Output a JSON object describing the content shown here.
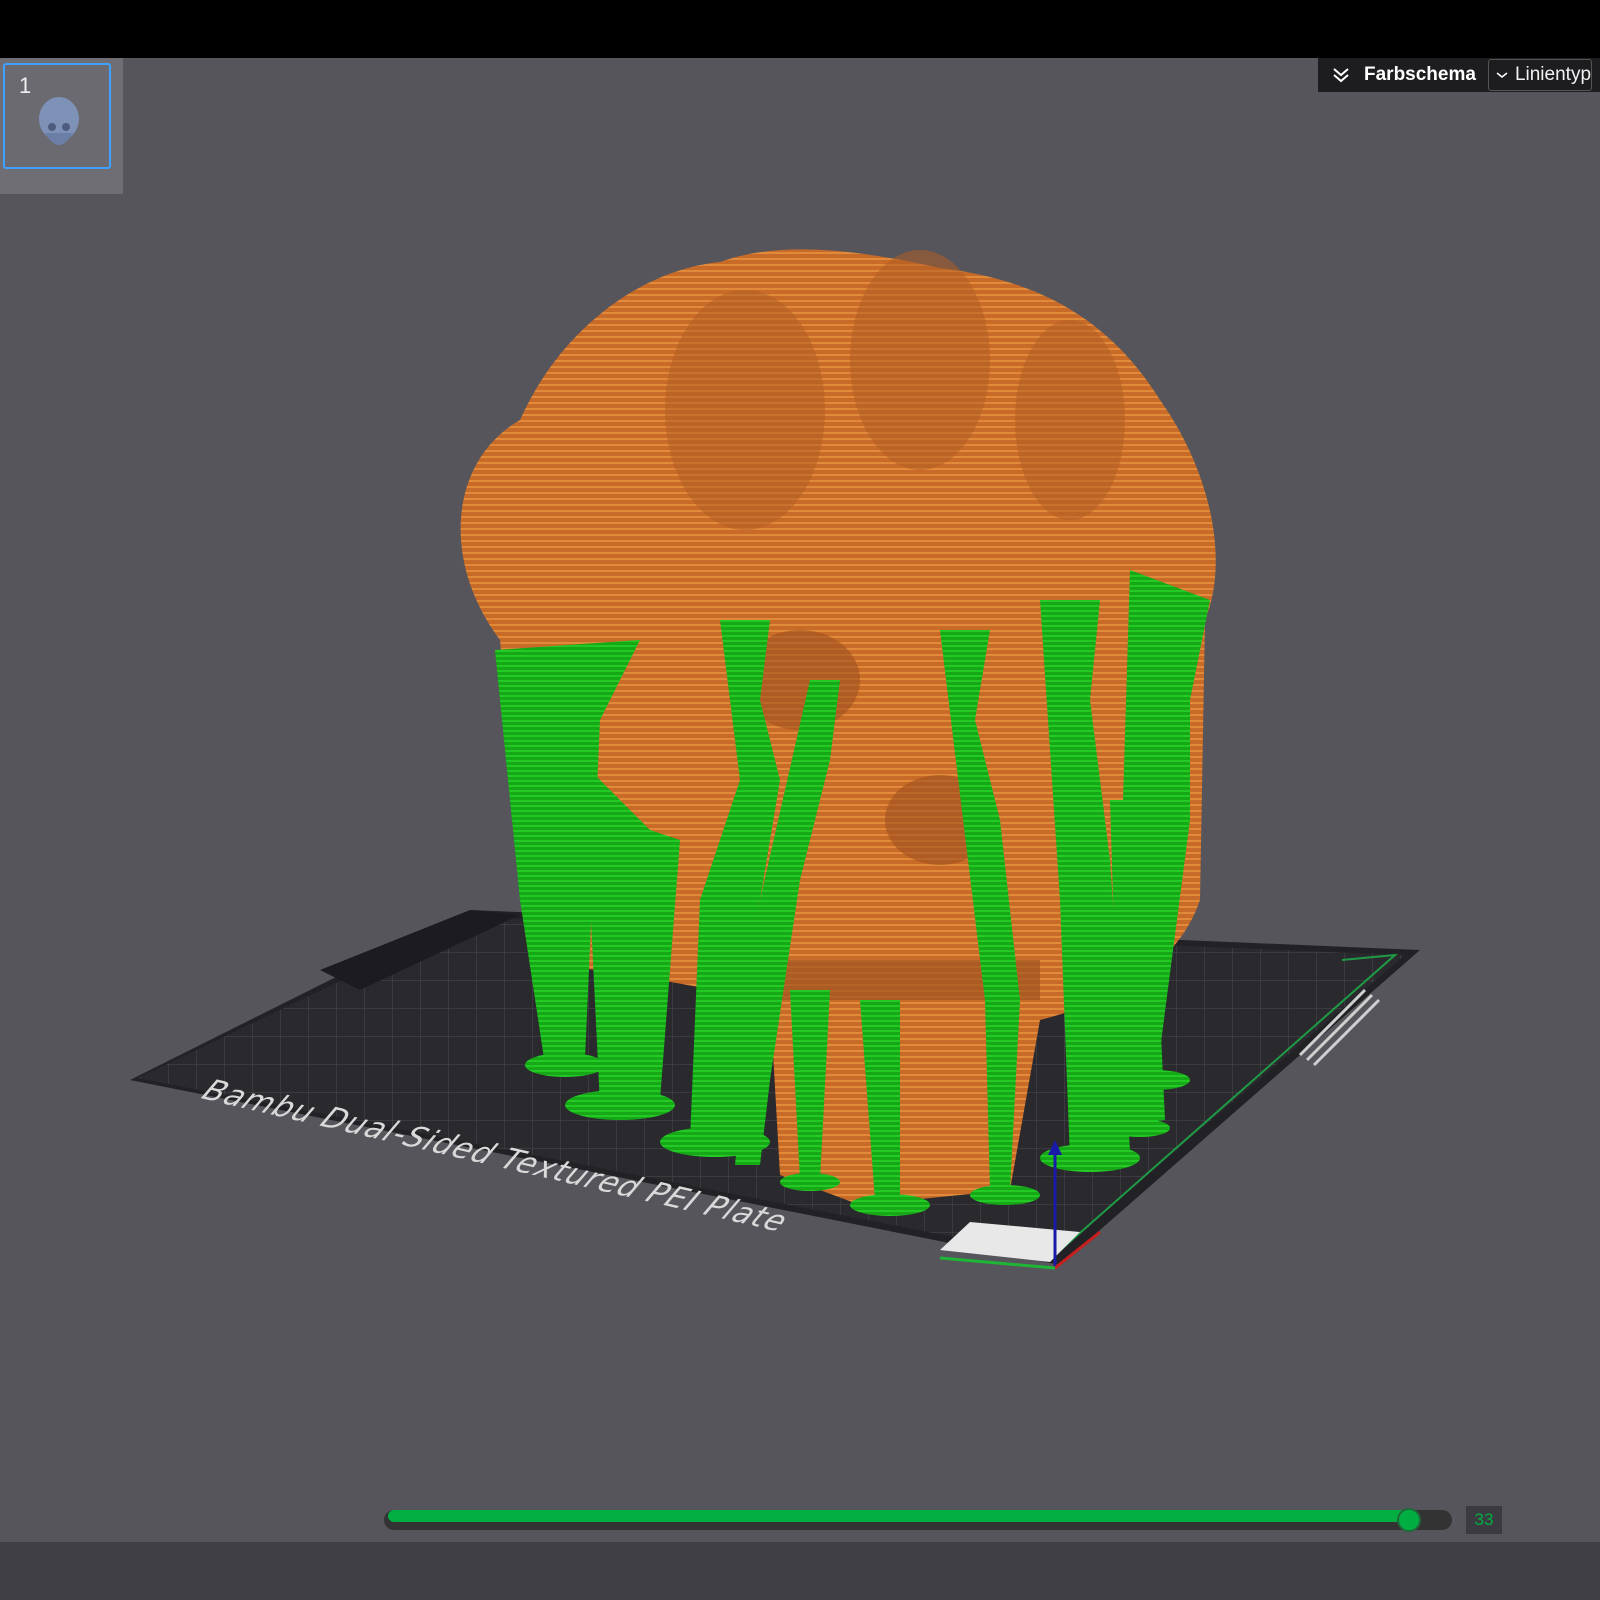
{
  "window": {
    "title": ""
  },
  "plates": {
    "items": [
      {
        "number": "1"
      }
    ]
  },
  "toolbar": {
    "color_scheme_label": "Farbschema",
    "line_type_label": "Linientyp",
    "collapse_icon": "double-chevron-down-icon",
    "dropdown_icon": "chevron-down-icon"
  },
  "scene": {
    "bed_label": "Bambu Dual-Sided Textured PEI Plate",
    "colors": {
      "model": "#c86a28",
      "support": "#19b51a",
      "bed": "#2a2a2e",
      "background": "#55555b",
      "accent": "#00ae42"
    }
  },
  "layer_slider": {
    "value": "33",
    "position_fraction": 0.97
  }
}
